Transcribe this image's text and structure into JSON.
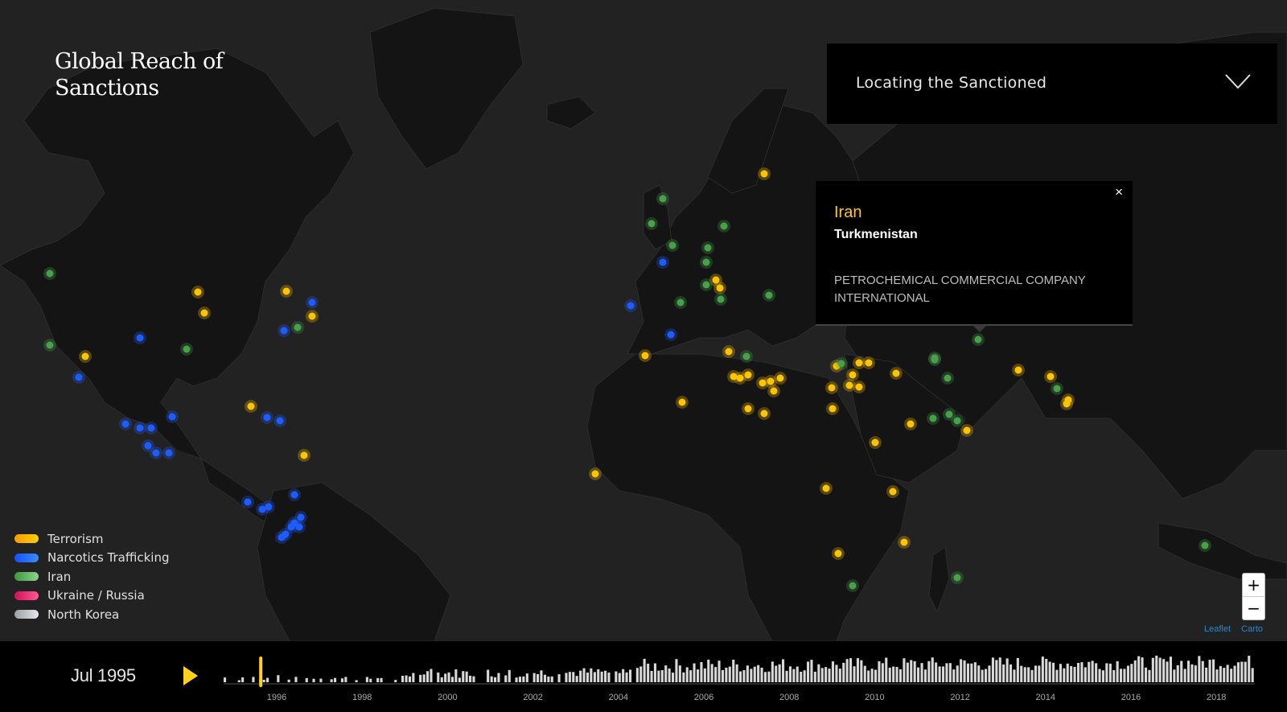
{
  "title": "Global Reach of Sanctions",
  "dropdown": {
    "label": "Locating the Sanctioned"
  },
  "popup": {
    "close": "×",
    "category": "Iran",
    "country": "Turkmenistan",
    "entity": "PETROCHEMICAL COMMERCIAL COMPANY INTERNATIONAL"
  },
  "legend": [
    {
      "label": "Terrorism",
      "color": "#ffb000"
    },
    {
      "label": "Narcotics Trafficking",
      "color": "#1e6bff"
    },
    {
      "label": "Iran",
      "color": "#4caa4c"
    },
    {
      "label": "Ukraine / Russia",
      "color": "#e0206b"
    },
    {
      "label": "North Korea",
      "color": "#bfc3c7"
    }
  ],
  "zoom": {
    "in": "+",
    "out": "−"
  },
  "attribution": {
    "leaflet": "Leaflet",
    "carto": "Carto"
  },
  "timeline": {
    "current_date": "Jul 1995",
    "years": [
      "1996",
      "1998",
      "2000",
      "2002",
      "2004",
      "2006",
      "2008",
      "2010",
      "2012",
      "2014",
      "2016",
      "2018"
    ],
    "current_fraction": 0.036
  },
  "colors": {
    "terrorism": "#ffc400",
    "narcotics": "#1f5cff",
    "iran": "#49a04b"
  }
}
